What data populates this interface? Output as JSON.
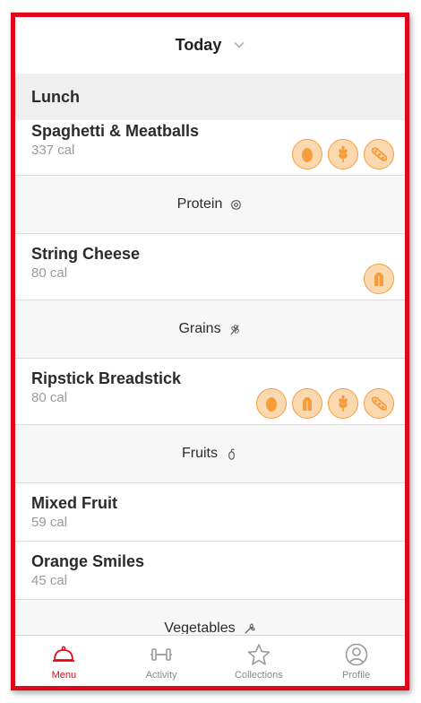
{
  "header": {
    "title": "Today"
  },
  "section": {
    "title": "Lunch"
  },
  "items": [
    {
      "name": "Spaghetti & Meatballs",
      "cal": "337 cal",
      "icons": [
        "egg-icon",
        "wheat-icon",
        "soy-icon"
      ]
    },
    {
      "name": "String Cheese",
      "cal": "80 cal",
      "icons": [
        "milk-icon"
      ]
    },
    {
      "name": "Ripstick Breadstick",
      "cal": "80 cal",
      "icons": [
        "egg-icon",
        "milk-icon",
        "wheat-icon",
        "soy-icon"
      ]
    },
    {
      "name": "Mixed Fruit",
      "cal": "59 cal",
      "icons": []
    },
    {
      "name": "Orange Smiles",
      "cal": "45 cal",
      "icons": []
    }
  ],
  "dividers": {
    "protein": "Protein",
    "grains": "Grains",
    "fruits": "Fruits",
    "vegetables": "Vegetables"
  },
  "tabs": [
    {
      "label": "Menu",
      "icon": "cloche-icon",
      "active": true
    },
    {
      "label": "Activity",
      "icon": "dumbbell-icon",
      "active": false
    },
    {
      "label": "Collections",
      "icon": "star-icon",
      "active": false
    },
    {
      "label": "Profile",
      "icon": "person-icon",
      "active": false
    }
  ],
  "colors": {
    "accent": "#e3061b",
    "allergen_fill": "#fbd9b0",
    "allergen_stroke": "#f59c3d"
  }
}
